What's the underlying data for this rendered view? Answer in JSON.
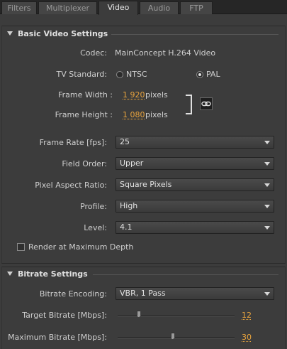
{
  "tabs": [
    {
      "label": "Filters"
    },
    {
      "label": "Multiplexer"
    },
    {
      "label": "Video"
    },
    {
      "label": "Audio"
    },
    {
      "label": "FTP"
    }
  ],
  "basic": {
    "title": "Basic Video Settings",
    "codec_label": "Codec:",
    "codec_value": "MainConcept H.264 Video",
    "tv_label": "TV Standard:",
    "ntsc": "NTSC",
    "pal": "PAL",
    "tv_selected": "PAL",
    "frame_width_label": "Frame Width :",
    "frame_width_value": "1 920",
    "frame_height_label": "Frame Height :",
    "frame_height_value": "1 080",
    "pixels": "pixels",
    "frame_rate_label": "Frame Rate [fps]:",
    "frame_rate_value": "25",
    "field_order_label": "Field Order:",
    "field_order_value": "Upper",
    "par_label": "Pixel Aspect Ratio:",
    "par_value": "Square Pixels",
    "profile_label": "Profile:",
    "profile_value": "High",
    "level_label": "Level:",
    "level_value": "4.1",
    "render_max_label": "Render at Maximum Depth",
    "render_max_checked": false
  },
  "bitrate": {
    "title": "Bitrate Settings",
    "encoding_label": "Bitrate Encoding:",
    "encoding_value": "VBR, 1 Pass",
    "target_label": "Target Bitrate [Mbps]:",
    "target_value": "12",
    "target_fraction": 0.18,
    "max_label": "Maximum Bitrate [Mbps]:",
    "max_value": "30",
    "max_fraction": 0.47
  },
  "colors": {
    "accent_value": "#e8a33d",
    "background": "#3c3c3c",
    "tab_bar": "#262626"
  }
}
